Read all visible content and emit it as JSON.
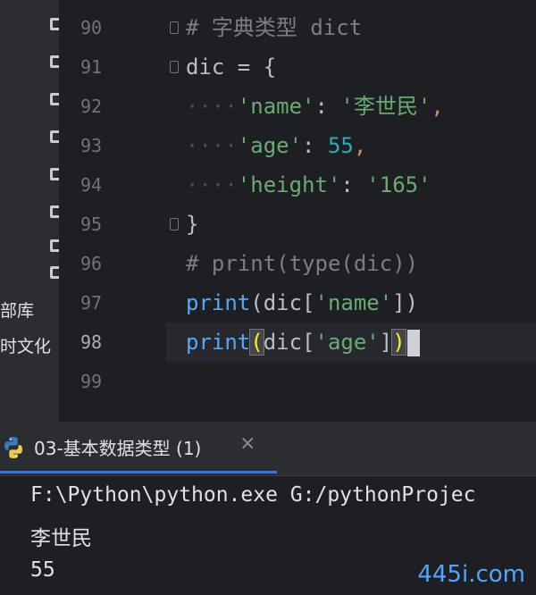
{
  "sidebar": {
    "labels": [
      "部库",
      "时文化"
    ]
  },
  "editor": {
    "current_line": 98,
    "lines": [
      {
        "num": "90",
        "segments": [
          [
            "cm",
            "# 字典类型 dict"
          ]
        ]
      },
      {
        "num": "91",
        "segments": [
          [
            "plain",
            "dic = {"
          ]
        ]
      },
      {
        "num": "92",
        "segments": [
          [
            "dots",
            "····"
          ],
          [
            "str",
            "'name'"
          ],
          [
            "plain",
            ": "
          ],
          [
            "str",
            "'李世民'"
          ],
          [
            "kw",
            ","
          ]
        ]
      },
      {
        "num": "93",
        "segments": [
          [
            "dots",
            "····"
          ],
          [
            "str",
            "'age'"
          ],
          [
            "plain",
            ": "
          ],
          [
            "num",
            "55"
          ],
          [
            "kw",
            ","
          ]
        ]
      },
      {
        "num": "94",
        "segments": [
          [
            "dots",
            "····"
          ],
          [
            "str",
            "'height'"
          ],
          [
            "plain",
            ": "
          ],
          [
            "str",
            "'165'"
          ]
        ]
      },
      {
        "num": "95",
        "segments": [
          [
            "plain",
            "}"
          ]
        ]
      },
      {
        "num": "96",
        "segments": [
          [
            "cm",
            "# print(type(dic))"
          ]
        ]
      },
      {
        "num": "97",
        "segments": [
          [
            "fn",
            "print"
          ],
          [
            "plain",
            "(dic["
          ],
          [
            "str",
            "'name'"
          ],
          [
            "plain",
            "])"
          ]
        ]
      },
      {
        "num": "98",
        "segments": [
          [
            "fn",
            "print"
          ],
          [
            "hl",
            "("
          ],
          [
            "plain",
            "dic["
          ],
          [
            "str",
            "'age'"
          ],
          [
            "plain",
            "]"
          ],
          [
            "hl",
            ")"
          ]
        ]
      },
      {
        "num": "99",
        "segments": []
      }
    ]
  },
  "run_panel": {
    "tab_title": "03-基本数据类型 (1)",
    "close_glyph": "×",
    "output": [
      "F:\\Python\\python.exe G:/pythonProjec",
      "李世民",
      "55"
    ]
  },
  "watermark": "445i.com",
  "colors": {
    "background": "#1e1f22",
    "string": "#6aab73",
    "keyword": "#cf8e6d",
    "function": "#56a8f5",
    "number": "#2aacb8",
    "accent": "#3574f0"
  }
}
